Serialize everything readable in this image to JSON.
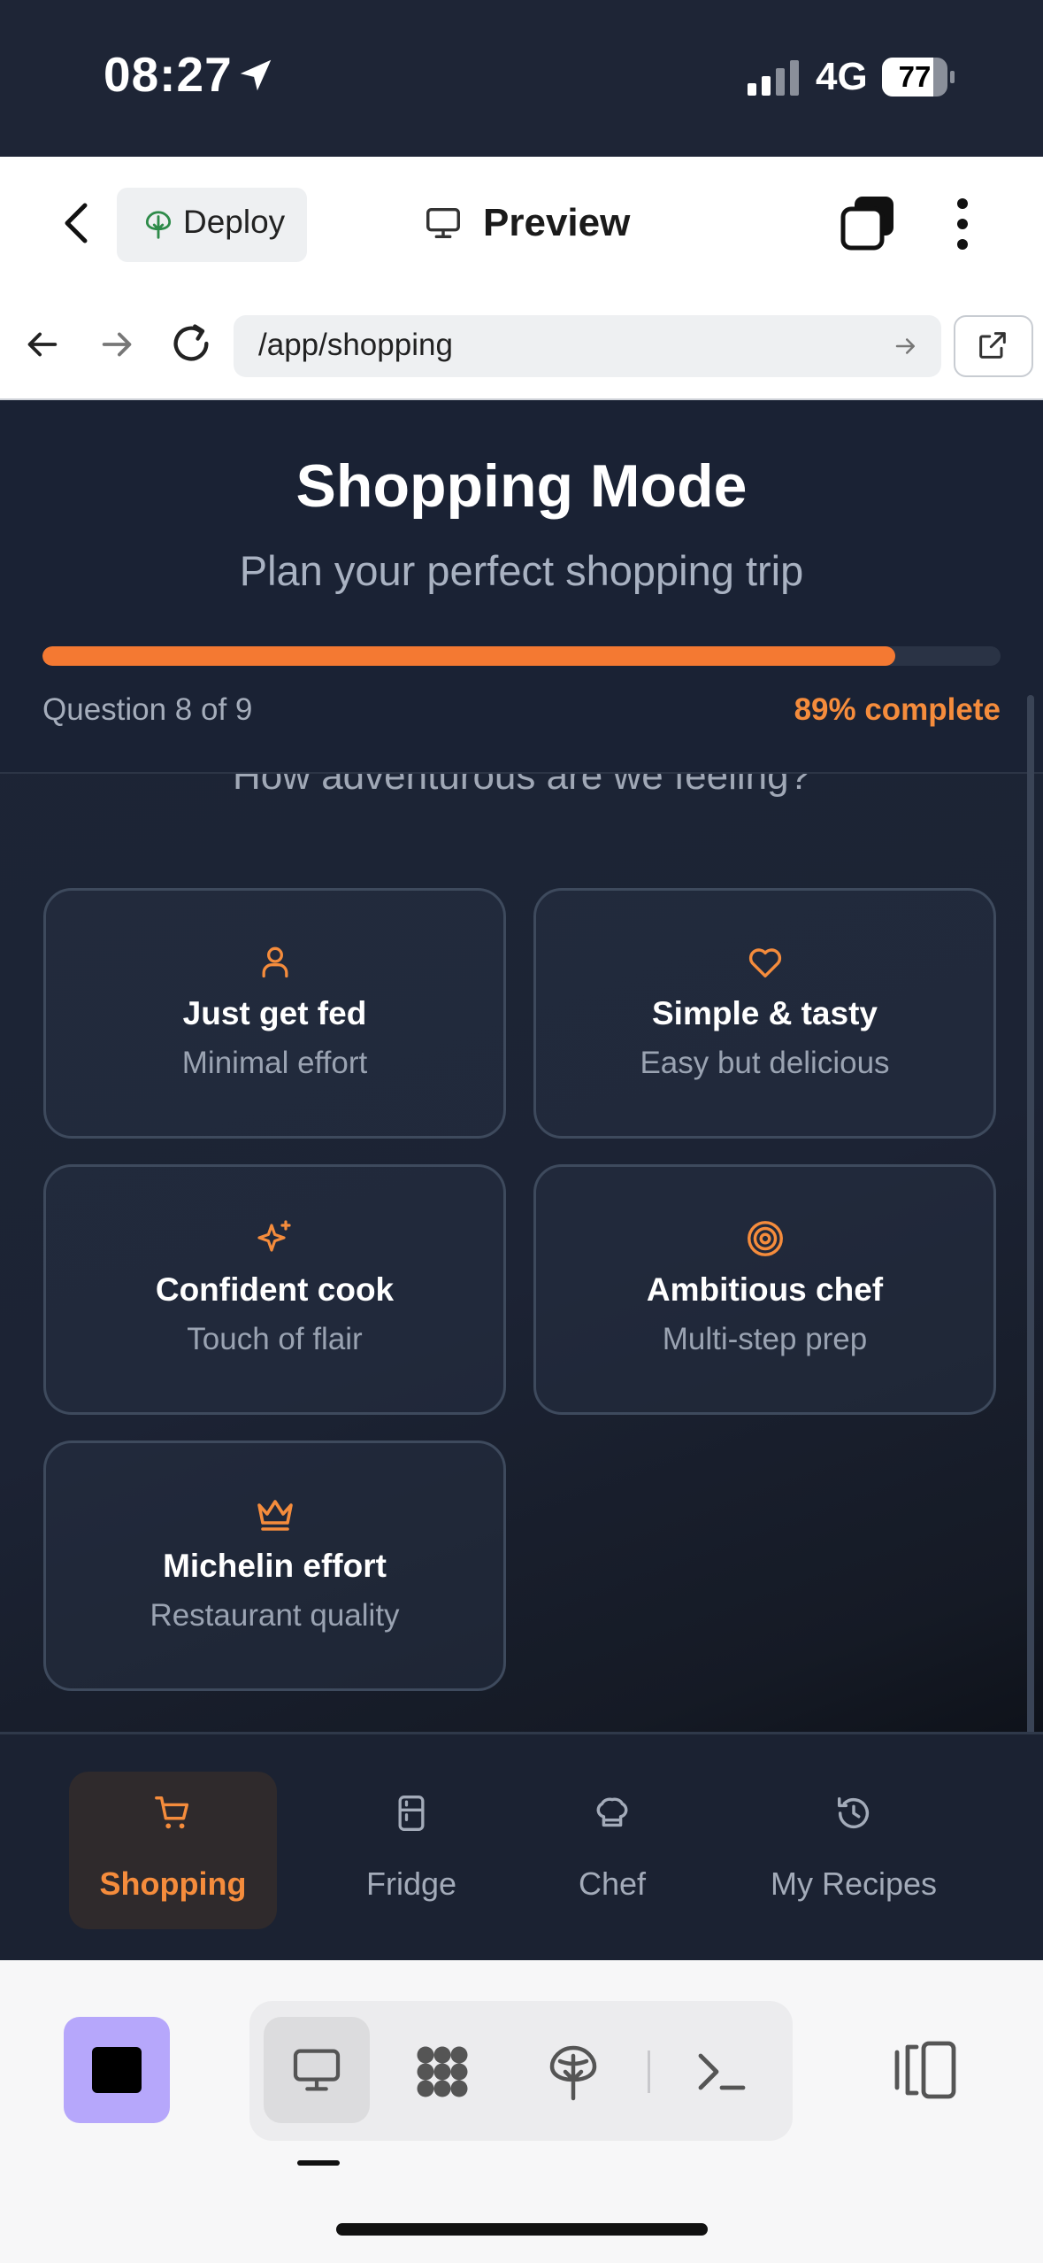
{
  "status_bar": {
    "time": "08:27",
    "network": "4G",
    "battery": "77"
  },
  "toolbar": {
    "deploy_label": "Deploy",
    "preview_label": "Preview"
  },
  "url_bar": {
    "url": "/app/shopping"
  },
  "header": {
    "title": "Shopping Mode",
    "subtitle": "Plan your perfect shopping trip",
    "question_count": "Question 8 of 9",
    "percent_complete": "89% complete",
    "progress_fraction": 0.89,
    "accent_color": "#f47932"
  },
  "question": {
    "text": "How adventurous are we feeling?"
  },
  "options": [
    {
      "title": "Just get fed",
      "subtitle": "Minimal effort",
      "icon": "person-icon"
    },
    {
      "title": "Simple & tasty",
      "subtitle": "Easy but delicious",
      "icon": "heart-icon"
    },
    {
      "title": "Confident cook",
      "subtitle": "Touch of flair",
      "icon": "sparkles-icon"
    },
    {
      "title": "Ambitious chef",
      "subtitle": "Multi-step prep",
      "icon": "target-icon"
    },
    {
      "title": "Michelin effort",
      "subtitle": "Restaurant quality",
      "icon": "crown-icon"
    }
  ],
  "nav": {
    "shopping": "Shopping",
    "fridge": "Fridge",
    "chef": "Chef",
    "recipes": "My Recipes"
  }
}
